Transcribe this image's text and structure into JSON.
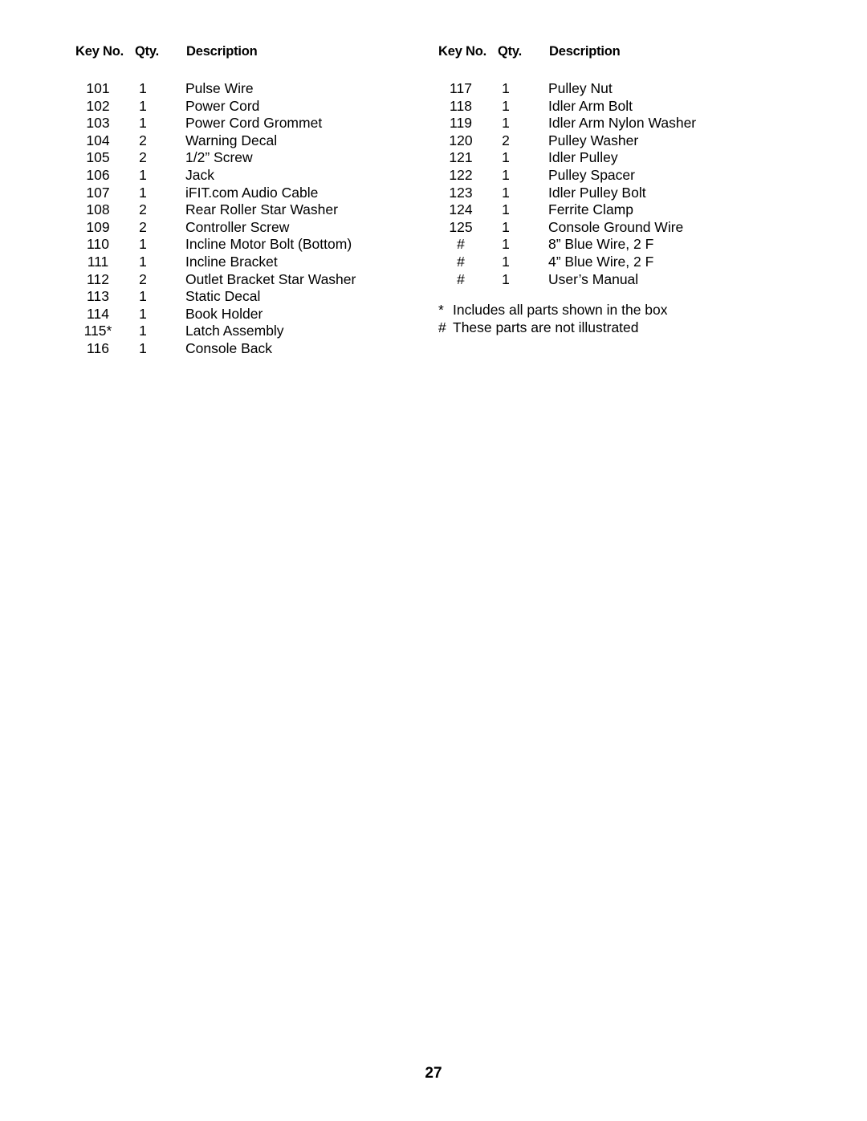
{
  "document": {
    "page_number": "27"
  },
  "table": {
    "headers": {
      "key_no": "Key No.",
      "qty": "Qty.",
      "description": "Description"
    },
    "left_column": [
      {
        "key": "101",
        "qty": "1",
        "description": "Pulse Wire"
      },
      {
        "key": "102",
        "qty": "1",
        "description": "Power Cord"
      },
      {
        "key": "103",
        "qty": "1",
        "description": "Power Cord Grommet"
      },
      {
        "key": "104",
        "qty": "2",
        "description": "Warning Decal"
      },
      {
        "key": "105",
        "qty": "2",
        "description": "1/2” Screw"
      },
      {
        "key": "106",
        "qty": "1",
        "description": "Jack"
      },
      {
        "key": "107",
        "qty": "1",
        "description": "iFIT.com Audio Cable"
      },
      {
        "key": "108",
        "qty": "2",
        "description": "Rear Roller Star Washer"
      },
      {
        "key": "109",
        "qty": "2",
        "description": "Controller Screw"
      },
      {
        "key": "110",
        "qty": "1",
        "description": "Incline Motor Bolt (Bottom)"
      },
      {
        "key": "111",
        "qty": "1",
        "description": "Incline Bracket"
      },
      {
        "key": "112",
        "qty": "2",
        "description": "Outlet Bracket Star Washer"
      },
      {
        "key": "113",
        "qty": "1",
        "description": "Static Decal"
      },
      {
        "key": "114",
        "qty": "1",
        "description": "Book Holder"
      },
      {
        "key": "115*",
        "qty": "1",
        "description": "Latch Assembly"
      },
      {
        "key": "116",
        "qty": "1",
        "description": "Console Back"
      }
    ],
    "right_column": [
      {
        "key": "117",
        "qty": "1",
        "description": "Pulley Nut"
      },
      {
        "key": "118",
        "qty": "1",
        "description": "Idler Arm Bolt"
      },
      {
        "key": "119",
        "qty": "1",
        "description": "Idler Arm Nylon Washer"
      },
      {
        "key": "120",
        "qty": "2",
        "description": "Pulley Washer"
      },
      {
        "key": "121",
        "qty": "1",
        "description": "Idler Pulley"
      },
      {
        "key": "122",
        "qty": "1",
        "description": "Pulley Spacer"
      },
      {
        "key": "123",
        "qty": "1",
        "description": "Idler Pulley Bolt"
      },
      {
        "key": "124",
        "qty": "1",
        "description": "Ferrite Clamp"
      },
      {
        "key": "125",
        "qty": "1",
        "description": "Console Ground Wire"
      },
      {
        "key": "#",
        "qty": "1",
        "description": "8” Blue Wire, 2 F"
      },
      {
        "key": "#",
        "qty": "1",
        "description": "4” Blue Wire, 2 F"
      },
      {
        "key": "#",
        "qty": "1",
        "description": "User’s Manual"
      }
    ]
  },
  "footnotes": [
    {
      "mark": "*",
      "text": "Includes all parts shown in the box"
    },
    {
      "mark": "#",
      "text": "These parts are not illustrated"
    }
  ]
}
